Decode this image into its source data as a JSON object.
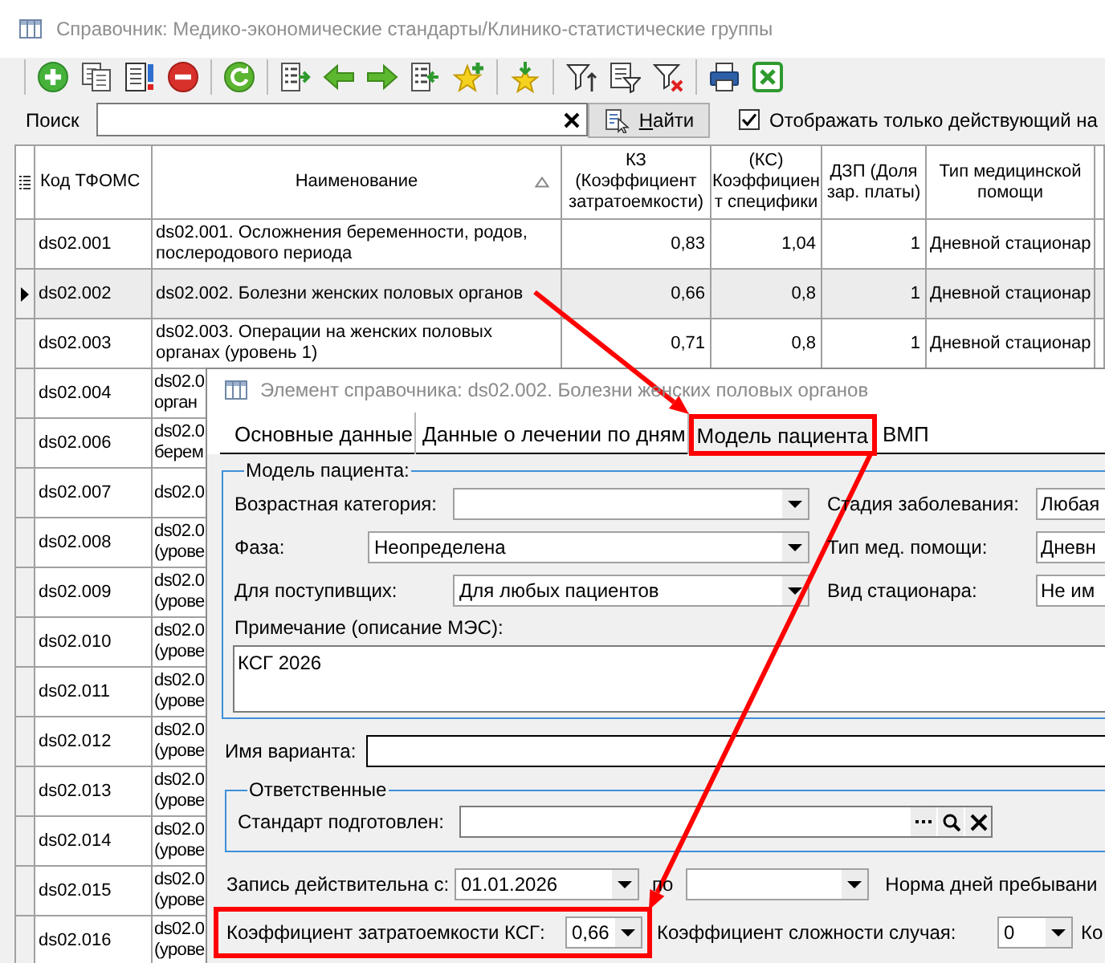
{
  "window": {
    "title": "Справочник: Медико-экономические стандарты/Клинико-статистические группы"
  },
  "search": {
    "label": "Поиск",
    "find_button": "Найти",
    "active_only": {
      "label": "Отображать только действующий на",
      "checked": true
    }
  },
  "table": {
    "columns": [
      {
        "label": "Код ТФОМС",
        "sorted": false
      },
      {
        "label": "Наименование",
        "sorted": true
      },
      {
        "label": "КЗ\n(Коэффициент\nзатратоемкости)",
        "sorted": false
      },
      {
        "label": "(КС)\nКоэффициен\nт специфики",
        "sorted": false
      },
      {
        "label": "ДЗП (Доля\nзар. платы)",
        "sorted": false
      },
      {
        "label": "Тип медицинской\nпомощи",
        "sorted": false
      }
    ],
    "rows": [
      {
        "code": "ds02.001",
        "name": "ds02.001. Осложнения беременности, родов, послеродового периода",
        "kz": "0,83",
        "ks": "1,04",
        "dzp": "1",
        "care_type": "Дневной стационар",
        "selected": false
      },
      {
        "code": "ds02.002",
        "name": "ds02.002. Болезни женских половых органов",
        "kz": "0,66",
        "ks": "0,8",
        "dzp": "1",
        "care_type": "Дневной стационар",
        "selected": true
      },
      {
        "code": "ds02.003",
        "name": "ds02.003. Операции на женских половых органах (уровень 1)",
        "kz": "0,71",
        "ks": "0,8",
        "dzp": "1",
        "care_type": "Дневной стационар",
        "selected": false
      },
      {
        "code": "ds02.004",
        "name": "ds02.0 орган",
        "selected": false
      },
      {
        "code": "ds02.006",
        "name": "ds02.0 берем",
        "selected": false
      },
      {
        "code": "ds02.007",
        "name": "ds02.0",
        "selected": false
      },
      {
        "code": "ds02.008",
        "name": "ds02.0 (урове",
        "selected": false
      },
      {
        "code": "ds02.009",
        "name": "ds02.0 (урове",
        "selected": false
      },
      {
        "code": "ds02.010",
        "name": "ds02.0 (урове",
        "selected": false
      },
      {
        "code": "ds02.011",
        "name": "ds02.0 (урове",
        "selected": false
      },
      {
        "code": "ds02.012",
        "name": "ds02.0 (урове",
        "selected": false
      },
      {
        "code": "ds02.013",
        "name": "ds02.0 (урове",
        "selected": false
      },
      {
        "code": "ds02.014",
        "name": "ds02.0 (урове",
        "selected": false
      },
      {
        "code": "ds02.015",
        "name": "ds02.0 (урове",
        "selected": false
      },
      {
        "code": "ds02.016",
        "name": "ds02.0 (урове",
        "selected": false
      }
    ]
  },
  "dialog": {
    "title": "Элемент справочника: ds02.002. Болезни женских половых органов",
    "tabs": [
      {
        "label": "Основные данные",
        "selected": false,
        "highlighted": false
      },
      {
        "label": "Данные о лечении по дням",
        "selected": false,
        "highlighted": false
      },
      {
        "label": "Модель пациента",
        "selected": true,
        "highlighted": true
      },
      {
        "label": "ВМП",
        "selected": false,
        "highlighted": false
      }
    ],
    "patient_model": {
      "legend": "Модель пациента:",
      "fields": [
        {
          "label": "Возрастная категория:"
        },
        {
          "label": "Стадия заболевания:",
          "value": "Любая"
        },
        {
          "label": "Фаза:",
          "value": "Неопределена"
        },
        {
          "label": "Тип мед. помощи:",
          "value": "Дневн"
        },
        {
          "label": "Для поступивщих:",
          "value": "Для любых пациентов"
        },
        {
          "label": "Вид стационара:",
          "value": "Не им"
        }
      ],
      "note": {
        "label": "Примечание (описание МЭС):",
        "value": "КСГ 2026"
      }
    },
    "variant_name": {
      "label": "Имя варианта:"
    },
    "responsible": {
      "legend": "Ответственные",
      "prepared_by": {
        "label": "Стандарт подготовлен:"
      }
    },
    "valid_from": {
      "label": "Запись действительна с:",
      "value": "01.01.2026"
    },
    "valid_to": {
      "label": "по"
    },
    "stay_norm": {
      "label": "Норма дней пребывани"
    },
    "ksg_coefficient": {
      "label": "Коэффициент затратоемкости КСГ:",
      "value": "0,66",
      "highlighted": true
    },
    "complexity": {
      "label": "Коэффициент сложности случая:",
      "value": "0"
    },
    "column_cut": {
      "label": "Ко"
    }
  }
}
